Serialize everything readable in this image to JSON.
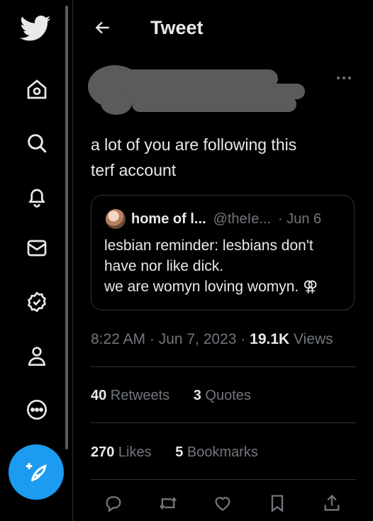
{
  "header": {
    "title": "Tweet"
  },
  "nav": {
    "items": [
      "home-icon",
      "search-icon",
      "notifications-icon",
      "messages-icon",
      "verified-icon",
      "profile-icon",
      "more-icon"
    ]
  },
  "tweet": {
    "text_lines": [
      "a lot of you are following this",
      "terf account"
    ],
    "quote": {
      "name": "home of l...",
      "handle": "@theIe...",
      "date": "· Jun 6",
      "lines": [
        "lesbian reminder: lesbians don't",
        "have nor like dick.",
        "we are womyn loving womyn. ⚢"
      ]
    },
    "time": "8:22 AM · Jun 7, 2023 · ",
    "views_count": "19.1K",
    "views_label": " Views"
  },
  "stats": {
    "retweets_count": "40",
    "retweets_label": " Retweets",
    "quotes_count": "3",
    "quotes_label": " Quotes",
    "likes_count": "270",
    "likes_label": " Likes",
    "bookmarks_count": "5",
    "bookmarks_label": " Bookmarks"
  },
  "colors": {
    "accent": "#1d9bf0",
    "background": "#000000",
    "text": "#e7e9ea",
    "muted": "#71767b",
    "border": "#2f3336"
  }
}
